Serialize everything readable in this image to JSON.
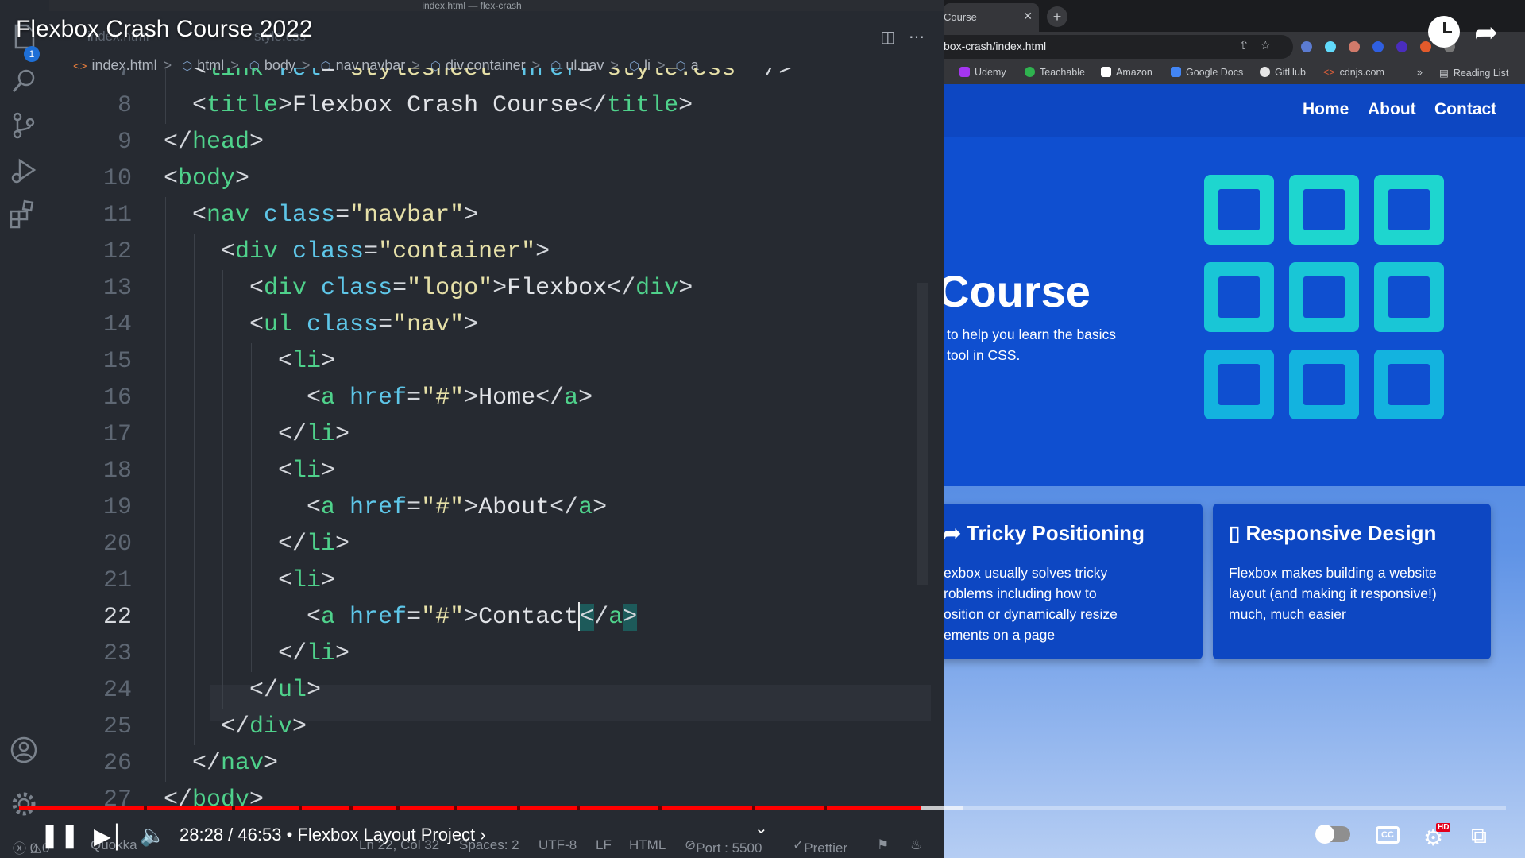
{
  "editor": {
    "window_title": "index.html — flex-crash",
    "ghost_tabs": [
      "index.html",
      "style.css"
    ],
    "breadcrumb": [
      "index.html",
      "html",
      "body",
      "nav.navbar",
      "div.container",
      "ul.nav",
      "li",
      "a"
    ],
    "activity_badge": "1",
    "code_lines": [
      {
        "n": "7",
        "indent": 1,
        "tokens": [
          [
            "p",
            "<"
          ],
          [
            "tag",
            "link"
          ],
          [
            "p",
            " "
          ],
          [
            "attr",
            "rel"
          ],
          [
            "p",
            "="
          ],
          [
            "str",
            "\"stylesheet\""
          ],
          [
            "p",
            " "
          ],
          [
            "attr",
            "href"
          ],
          [
            "p",
            "="
          ],
          [
            "str",
            "\"style.css\""
          ],
          [
            "p",
            " />"
          ]
        ]
      },
      {
        "n": "8",
        "indent": 1,
        "tokens": [
          [
            "p",
            "<"
          ],
          [
            "tag",
            "title"
          ],
          [
            "p",
            ">"
          ],
          [
            "txt",
            "Flexbox Crash Course"
          ],
          [
            "p",
            "</"
          ],
          [
            "tag",
            "title"
          ],
          [
            "p",
            ">"
          ]
        ]
      },
      {
        "n": "9",
        "indent": 0,
        "tokens": [
          [
            "p",
            "</"
          ],
          [
            "tag",
            "head"
          ],
          [
            "p",
            ">"
          ]
        ]
      },
      {
        "n": "10",
        "indent": 0,
        "tokens": [
          [
            "p",
            "<"
          ],
          [
            "tag",
            "body"
          ],
          [
            "p",
            ">"
          ]
        ]
      },
      {
        "n": "11",
        "indent": 1,
        "tokens": [
          [
            "p",
            "<"
          ],
          [
            "tag",
            "nav"
          ],
          [
            "p",
            " "
          ],
          [
            "attr",
            "class"
          ],
          [
            "p",
            "="
          ],
          [
            "str",
            "\"navbar\""
          ],
          [
            "p",
            ">"
          ]
        ]
      },
      {
        "n": "12",
        "indent": 2,
        "tokens": [
          [
            "p",
            "<"
          ],
          [
            "tag",
            "div"
          ],
          [
            "p",
            " "
          ],
          [
            "attr",
            "class"
          ],
          [
            "p",
            "="
          ],
          [
            "str",
            "\"container\""
          ],
          [
            "p",
            ">"
          ]
        ]
      },
      {
        "n": "13",
        "indent": 3,
        "tokens": [
          [
            "p",
            "<"
          ],
          [
            "tag",
            "div"
          ],
          [
            "p",
            " "
          ],
          [
            "attr",
            "class"
          ],
          [
            "p",
            "="
          ],
          [
            "str",
            "\"logo\""
          ],
          [
            "p",
            ">"
          ],
          [
            "txt",
            "Flexbox"
          ],
          [
            "p",
            "</"
          ],
          [
            "tag",
            "div"
          ],
          [
            "p",
            ">"
          ]
        ]
      },
      {
        "n": "14",
        "indent": 3,
        "tokens": [
          [
            "p",
            "<"
          ],
          [
            "tag",
            "ul"
          ],
          [
            "p",
            " "
          ],
          [
            "attr",
            "class"
          ],
          [
            "p",
            "="
          ],
          [
            "str",
            "\"nav\""
          ],
          [
            "p",
            ">"
          ]
        ]
      },
      {
        "n": "15",
        "indent": 4,
        "tokens": [
          [
            "p",
            "<"
          ],
          [
            "tag",
            "li"
          ],
          [
            "p",
            ">"
          ]
        ]
      },
      {
        "n": "16",
        "indent": 5,
        "tokens": [
          [
            "p",
            "<"
          ],
          [
            "tag",
            "a"
          ],
          [
            "p",
            " "
          ],
          [
            "attr",
            "href"
          ],
          [
            "p",
            "="
          ],
          [
            "str",
            "\"#\""
          ],
          [
            "p",
            ">"
          ],
          [
            "txt",
            "Home"
          ],
          [
            "p",
            "</"
          ],
          [
            "tag",
            "a"
          ],
          [
            "p",
            ">"
          ]
        ]
      },
      {
        "n": "17",
        "indent": 4,
        "tokens": [
          [
            "p",
            "</"
          ],
          [
            "tag",
            "li"
          ],
          [
            "p",
            ">"
          ]
        ]
      },
      {
        "n": "18",
        "indent": 4,
        "tokens": [
          [
            "p",
            "<"
          ],
          [
            "tag",
            "li"
          ],
          [
            "p",
            ">"
          ]
        ]
      },
      {
        "n": "19",
        "indent": 5,
        "tokens": [
          [
            "p",
            "<"
          ],
          [
            "tag",
            "a"
          ],
          [
            "p",
            " "
          ],
          [
            "attr",
            "href"
          ],
          [
            "p",
            "="
          ],
          [
            "str",
            "\"#\""
          ],
          [
            "p",
            ">"
          ],
          [
            "txt",
            "About"
          ],
          [
            "p",
            "</"
          ],
          [
            "tag",
            "a"
          ],
          [
            "p",
            ">"
          ]
        ]
      },
      {
        "n": "20",
        "indent": 4,
        "tokens": [
          [
            "p",
            "</"
          ],
          [
            "tag",
            "li"
          ],
          [
            "p",
            ">"
          ]
        ]
      },
      {
        "n": "21",
        "indent": 4,
        "tokens": [
          [
            "p",
            "<"
          ],
          [
            "tag",
            "li"
          ],
          [
            "p",
            ">"
          ]
        ]
      },
      {
        "n": "22",
        "indent": 5,
        "active": true,
        "tokens": [
          [
            "p",
            "<"
          ],
          [
            "tag",
            "a"
          ],
          [
            "p",
            " "
          ],
          [
            "attr",
            "href"
          ],
          [
            "p",
            "="
          ],
          [
            "str",
            "\"#\""
          ],
          [
            "p",
            ">"
          ],
          [
            "txt",
            "Contact"
          ],
          [
            "caret",
            ""
          ],
          [
            "hl",
            "<"
          ],
          [
            "p",
            "/"
          ],
          [
            "tag",
            "a"
          ],
          [
            "hl",
            ">"
          ]
        ]
      },
      {
        "n": "23",
        "indent": 4,
        "tokens": [
          [
            "p",
            "</"
          ],
          [
            "tag",
            "li"
          ],
          [
            "p",
            ">"
          ]
        ]
      },
      {
        "n": "24",
        "indent": 3,
        "tokens": [
          [
            "p",
            "</"
          ],
          [
            "tag",
            "ul"
          ],
          [
            "p",
            ">"
          ]
        ]
      },
      {
        "n": "25",
        "indent": 2,
        "tokens": [
          [
            "p",
            "</"
          ],
          [
            "tag",
            "div"
          ],
          [
            "p",
            ">"
          ]
        ]
      },
      {
        "n": "26",
        "indent": 1,
        "tokens": [
          [
            "p",
            "</"
          ],
          [
            "tag",
            "nav"
          ],
          [
            "p",
            ">"
          ]
        ]
      },
      {
        "n": "27",
        "indent": 0,
        "tokens": [
          [
            "p",
            "</"
          ],
          [
            "tag",
            "body"
          ],
          [
            "p",
            ">"
          ]
        ]
      }
    ],
    "status": {
      "errors": "0",
      "warnings": "0",
      "quokka": "Quokka",
      "position": "Ln 22, Col 32",
      "spaces": "Spaces: 2",
      "encoding": "UTF-8",
      "eol": "LF",
      "language": "HTML",
      "port": "Port : 5500",
      "prettier": "Prettier"
    }
  },
  "browser": {
    "tab_title": "Course",
    "url": "box-crash/index.html",
    "bookmarks": [
      "Udemy",
      "Teachable",
      "Amazon",
      "Google Docs",
      "GitHub",
      "cdnjs.com"
    ],
    "reading_list": "Reading List",
    "page": {
      "nav_links": [
        "Home",
        "About",
        "Contact"
      ],
      "hero_title": "Course",
      "hero_text": "to help you learn the basics tool in CSS.",
      "hero_text_line1": "to help you learn the basics",
      "hero_text_line2": "tool in CSS.",
      "cards": [
        {
          "title": "Tricky Positioning",
          "icon": "arrows-icon",
          "text_lines": [
            "exbox usually solves tricky",
            "roblems including how to",
            "osition or dynamically resize",
            "ements on a page"
          ]
        },
        {
          "title": "Responsive Design",
          "icon": "mobile-icon",
          "text_lines": [
            "Flexbox makes building a website",
            "layout (and making it responsive!)",
            "much, much easier"
          ]
        }
      ]
    }
  },
  "video": {
    "title": "Flexbox Crash Course 2022",
    "time": "28:28 / 46:53",
    "chapter": "Flexbox Layout Project",
    "played_fraction": 0.607,
    "buffered_fraction": 0.635,
    "cc_label": "CC",
    "hd_label": "HD"
  },
  "colors": {
    "editor_bg": "#262a31",
    "tag": "#4fd18b",
    "attr": "#5ec6e8",
    "string": "#e6e0a8",
    "page_blue": "#0f4fd0",
    "progress_red": "#ff0000"
  }
}
